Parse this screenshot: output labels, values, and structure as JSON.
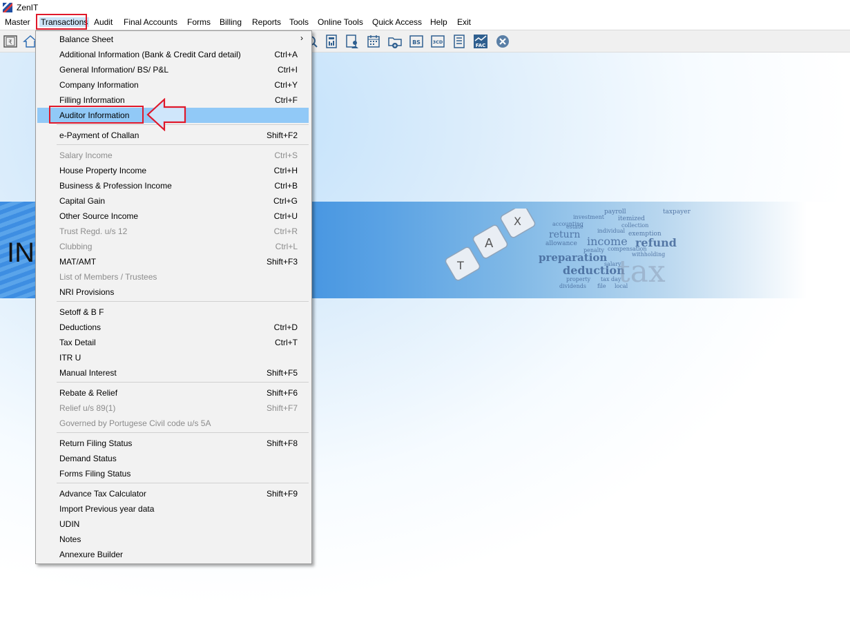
{
  "window": {
    "title": "ZenIT"
  },
  "menubar": {
    "items": [
      {
        "label": "Master"
      },
      {
        "label": "Transactions"
      },
      {
        "label": "Audit"
      },
      {
        "label": "Final Accounts"
      },
      {
        "label": "Forms"
      },
      {
        "label": "Billing"
      },
      {
        "label": "Reports"
      },
      {
        "label": "Tools"
      },
      {
        "label": "Online Tools"
      },
      {
        "label": "Quick Access"
      },
      {
        "label": "Help"
      },
      {
        "label": "Exit"
      }
    ],
    "active": "Transactions"
  },
  "toolbar": {
    "icons": [
      "rupee-book-icon",
      "home-icon",
      "search-doc-icon",
      "calculator-icon",
      "user-doc-icon",
      "calendar-icon",
      "folder-add-icon",
      "bs-icon",
      "3cd-icon",
      "document-icon",
      "fac-icon",
      "close-circle-icon"
    ],
    "bs_label": "BS",
    "cd_label": "3CD",
    "fac_label": "FAC"
  },
  "banner": {
    "text": "INC",
    "words": [
      "payroll",
      "taxpayer",
      "investment",
      "itemized",
      "accounting",
      "collection",
      "individual",
      "income",
      "refund",
      "exemption",
      "allowance",
      "penalty",
      "compensation",
      "preparation",
      "deduction",
      "withholding",
      "salary",
      "property",
      "tax day",
      "dividends",
      "file",
      "local",
      "tax",
      "return",
      "estate"
    ]
  },
  "transactions_menu": {
    "items": [
      {
        "label": "Balance Sheet",
        "shortcut": "",
        "submenu": true,
        "enabled": true
      },
      {
        "label": "Additional Information (Bank & Credit Card detail)",
        "shortcut": "Ctrl+A",
        "enabled": true
      },
      {
        "label": "General Information/ BS/ P&L",
        "shortcut": "Ctrl+I",
        "enabled": true
      },
      {
        "label": "Company Information",
        "shortcut": "Ctrl+Y",
        "enabled": true
      },
      {
        "label": "Filling Information",
        "shortcut": "Ctrl+F",
        "enabled": true
      },
      {
        "label": "Auditor Information",
        "shortcut": "",
        "enabled": true,
        "selected": true
      },
      {
        "label": "e-Payment of Challan",
        "shortcut": "Shift+F2",
        "enabled": true
      },
      {
        "label": "Salary Income",
        "shortcut": "Ctrl+S",
        "enabled": false
      },
      {
        "label": "House Property Income",
        "shortcut": "Ctrl+H",
        "enabled": true
      },
      {
        "label": "Business & Profession Income",
        "shortcut": "Ctrl+B",
        "enabled": true
      },
      {
        "label": "Capital Gain",
        "shortcut": "Ctrl+G",
        "enabled": true
      },
      {
        "label": "Other Source Income",
        "shortcut": "Ctrl+U",
        "enabled": true
      },
      {
        "label": "Trust Regd. u/s 12",
        "shortcut": "Ctrl+R",
        "enabled": false
      },
      {
        "label": "Clubbing",
        "shortcut": "Ctrl+L",
        "enabled": false
      },
      {
        "label": "MAT/AMT",
        "shortcut": "Shift+F3",
        "enabled": true
      },
      {
        "label": "List of Members / Trustees",
        "shortcut": "",
        "enabled": false
      },
      {
        "label": "NRI Provisions",
        "shortcut": "",
        "enabled": true
      },
      {
        "label": "Setoff & B F",
        "shortcut": "",
        "enabled": true
      },
      {
        "label": "Deductions",
        "shortcut": "Ctrl+D",
        "enabled": true
      },
      {
        "label": "Tax Detail",
        "shortcut": "Ctrl+T",
        "enabled": true
      },
      {
        "label": "ITR U",
        "shortcut": "",
        "enabled": true
      },
      {
        "label": "Manual Interest",
        "shortcut": "Shift+F5",
        "enabled": true
      },
      {
        "label": "Rebate & Relief",
        "shortcut": "Shift+F6",
        "enabled": true
      },
      {
        "label": "Relief u/s 89(1)",
        "shortcut": "Shift+F7",
        "enabled": false
      },
      {
        "label": "Governed by Portugese Civil code u/s 5A",
        "shortcut": "",
        "enabled": false
      },
      {
        "label": "Return Filing Status",
        "shortcut": "Shift+F8",
        "enabled": true
      },
      {
        "label": "Demand Status",
        "shortcut": "",
        "enabled": true
      },
      {
        "label": "Forms Filing Status",
        "shortcut": "",
        "enabled": true
      },
      {
        "label": "Advance Tax Calculator",
        "shortcut": "Shift+F9",
        "enabled": true
      },
      {
        "label": "Import Previous year data",
        "shortcut": "",
        "enabled": true
      },
      {
        "label": "UDIN",
        "shortcut": "",
        "enabled": true
      },
      {
        "label": "Notes",
        "shortcut": "",
        "enabled": true
      },
      {
        "label": "Annexure Builder",
        "shortcut": "",
        "enabled": true
      }
    ]
  },
  "colors": {
    "highlight_box": "#e0182a",
    "selected_row": "#91c9f7",
    "disabled_text": "#8c8c8c",
    "menu_bg": "#f2f2f2"
  }
}
